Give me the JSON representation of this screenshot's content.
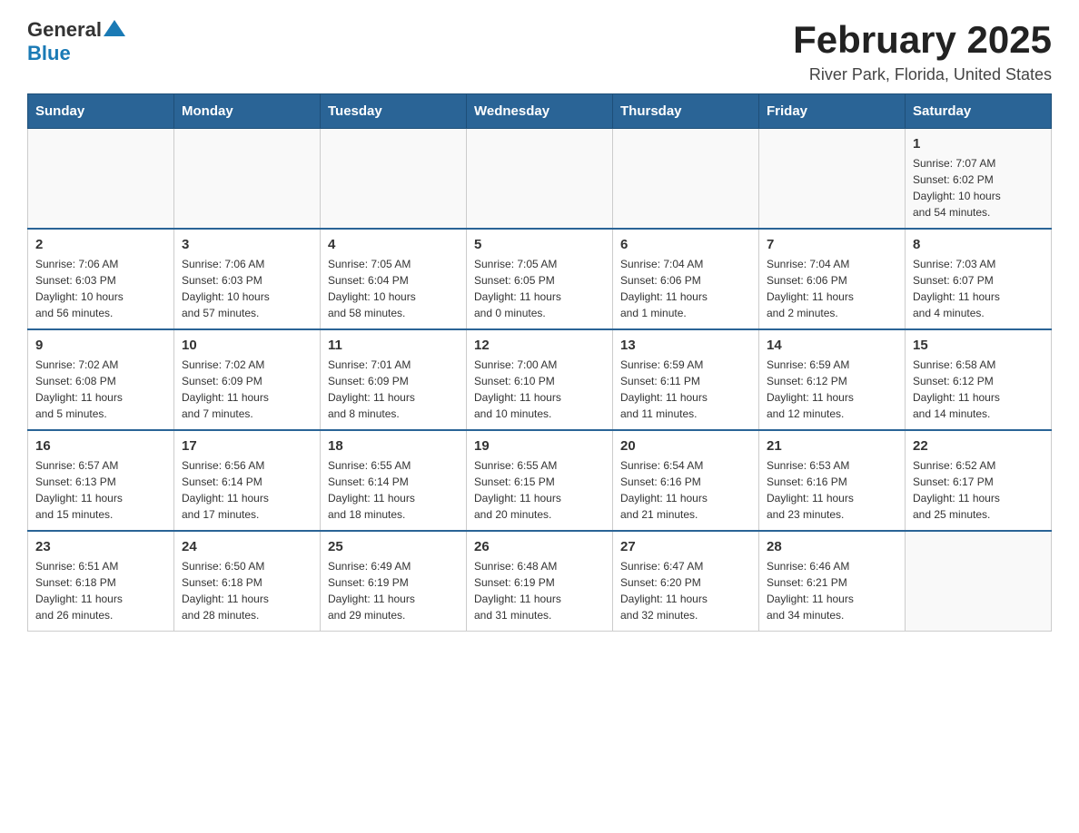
{
  "header": {
    "logo_general": "General",
    "logo_blue": "Blue",
    "title": "February 2025",
    "subtitle": "River Park, Florida, United States"
  },
  "days_of_week": [
    "Sunday",
    "Monday",
    "Tuesday",
    "Wednesday",
    "Thursday",
    "Friday",
    "Saturday"
  ],
  "weeks": [
    {
      "days": [
        {
          "date": "",
          "info": ""
        },
        {
          "date": "",
          "info": ""
        },
        {
          "date": "",
          "info": ""
        },
        {
          "date": "",
          "info": ""
        },
        {
          "date": "",
          "info": ""
        },
        {
          "date": "",
          "info": ""
        },
        {
          "date": "1",
          "info": "Sunrise: 7:07 AM\nSunset: 6:02 PM\nDaylight: 10 hours\nand 54 minutes."
        }
      ]
    },
    {
      "days": [
        {
          "date": "2",
          "info": "Sunrise: 7:06 AM\nSunset: 6:03 PM\nDaylight: 10 hours\nand 56 minutes."
        },
        {
          "date": "3",
          "info": "Sunrise: 7:06 AM\nSunset: 6:03 PM\nDaylight: 10 hours\nand 57 minutes."
        },
        {
          "date": "4",
          "info": "Sunrise: 7:05 AM\nSunset: 6:04 PM\nDaylight: 10 hours\nand 58 minutes."
        },
        {
          "date": "5",
          "info": "Sunrise: 7:05 AM\nSunset: 6:05 PM\nDaylight: 11 hours\nand 0 minutes."
        },
        {
          "date": "6",
          "info": "Sunrise: 7:04 AM\nSunset: 6:06 PM\nDaylight: 11 hours\nand 1 minute."
        },
        {
          "date": "7",
          "info": "Sunrise: 7:04 AM\nSunset: 6:06 PM\nDaylight: 11 hours\nand 2 minutes."
        },
        {
          "date": "8",
          "info": "Sunrise: 7:03 AM\nSunset: 6:07 PM\nDaylight: 11 hours\nand 4 minutes."
        }
      ]
    },
    {
      "days": [
        {
          "date": "9",
          "info": "Sunrise: 7:02 AM\nSunset: 6:08 PM\nDaylight: 11 hours\nand 5 minutes."
        },
        {
          "date": "10",
          "info": "Sunrise: 7:02 AM\nSunset: 6:09 PM\nDaylight: 11 hours\nand 7 minutes."
        },
        {
          "date": "11",
          "info": "Sunrise: 7:01 AM\nSunset: 6:09 PM\nDaylight: 11 hours\nand 8 minutes."
        },
        {
          "date": "12",
          "info": "Sunrise: 7:00 AM\nSunset: 6:10 PM\nDaylight: 11 hours\nand 10 minutes."
        },
        {
          "date": "13",
          "info": "Sunrise: 6:59 AM\nSunset: 6:11 PM\nDaylight: 11 hours\nand 11 minutes."
        },
        {
          "date": "14",
          "info": "Sunrise: 6:59 AM\nSunset: 6:12 PM\nDaylight: 11 hours\nand 12 minutes."
        },
        {
          "date": "15",
          "info": "Sunrise: 6:58 AM\nSunset: 6:12 PM\nDaylight: 11 hours\nand 14 minutes."
        }
      ]
    },
    {
      "days": [
        {
          "date": "16",
          "info": "Sunrise: 6:57 AM\nSunset: 6:13 PM\nDaylight: 11 hours\nand 15 minutes."
        },
        {
          "date": "17",
          "info": "Sunrise: 6:56 AM\nSunset: 6:14 PM\nDaylight: 11 hours\nand 17 minutes."
        },
        {
          "date": "18",
          "info": "Sunrise: 6:55 AM\nSunset: 6:14 PM\nDaylight: 11 hours\nand 18 minutes."
        },
        {
          "date": "19",
          "info": "Sunrise: 6:55 AM\nSunset: 6:15 PM\nDaylight: 11 hours\nand 20 minutes."
        },
        {
          "date": "20",
          "info": "Sunrise: 6:54 AM\nSunset: 6:16 PM\nDaylight: 11 hours\nand 21 minutes."
        },
        {
          "date": "21",
          "info": "Sunrise: 6:53 AM\nSunset: 6:16 PM\nDaylight: 11 hours\nand 23 minutes."
        },
        {
          "date": "22",
          "info": "Sunrise: 6:52 AM\nSunset: 6:17 PM\nDaylight: 11 hours\nand 25 minutes."
        }
      ]
    },
    {
      "days": [
        {
          "date": "23",
          "info": "Sunrise: 6:51 AM\nSunset: 6:18 PM\nDaylight: 11 hours\nand 26 minutes."
        },
        {
          "date": "24",
          "info": "Sunrise: 6:50 AM\nSunset: 6:18 PM\nDaylight: 11 hours\nand 28 minutes."
        },
        {
          "date": "25",
          "info": "Sunrise: 6:49 AM\nSunset: 6:19 PM\nDaylight: 11 hours\nand 29 minutes."
        },
        {
          "date": "26",
          "info": "Sunrise: 6:48 AM\nSunset: 6:19 PM\nDaylight: 11 hours\nand 31 minutes."
        },
        {
          "date": "27",
          "info": "Sunrise: 6:47 AM\nSunset: 6:20 PM\nDaylight: 11 hours\nand 32 minutes."
        },
        {
          "date": "28",
          "info": "Sunrise: 6:46 AM\nSunset: 6:21 PM\nDaylight: 11 hours\nand 34 minutes."
        },
        {
          "date": "",
          "info": ""
        }
      ]
    }
  ]
}
